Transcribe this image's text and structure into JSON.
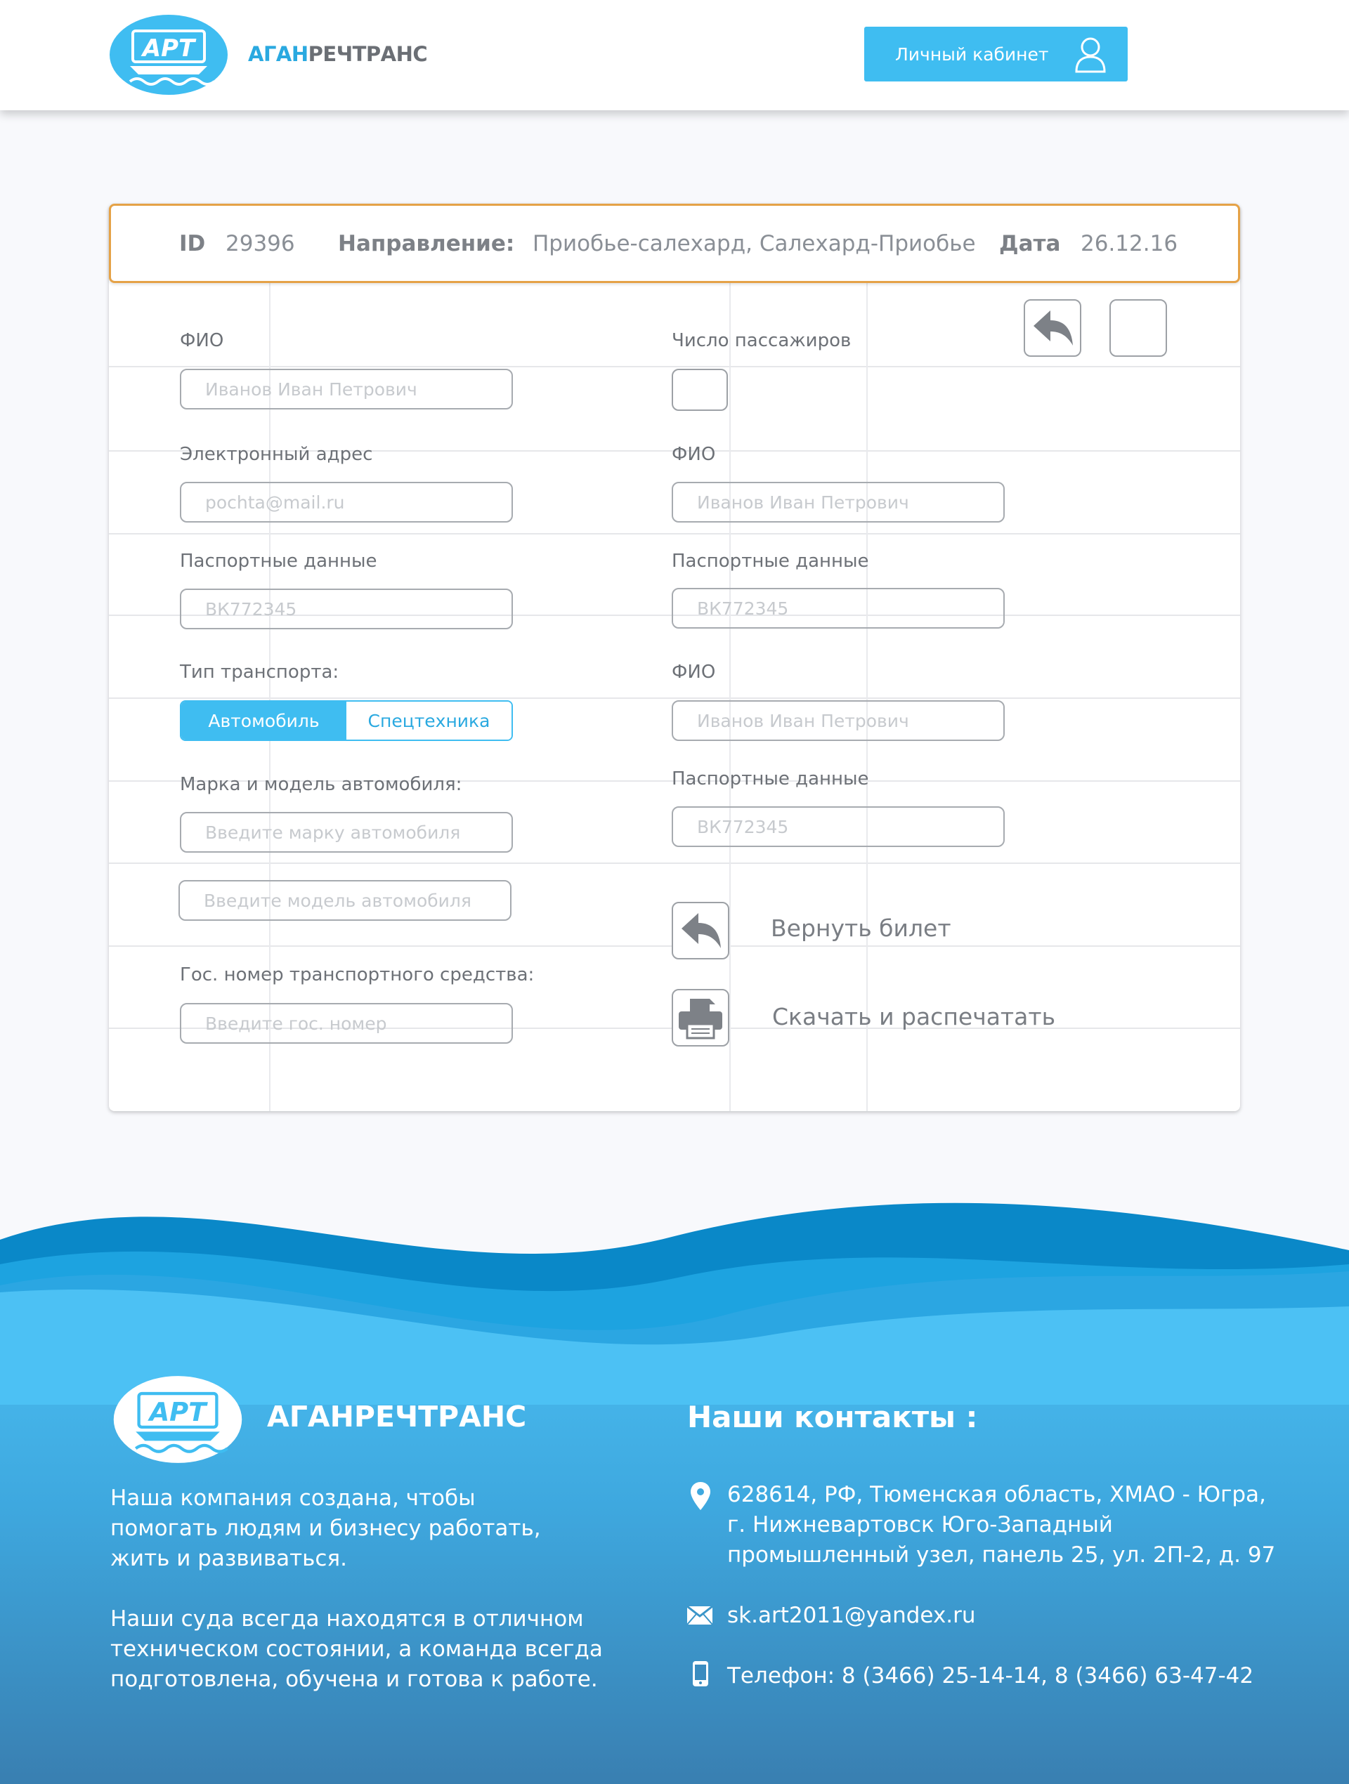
{
  "header": {
    "logo_text": "АРТ",
    "brand_part1": "АГАН",
    "brand_part2": "РЕЧТРАНС",
    "cabinet_label": "Личный кабинет"
  },
  "ticket": {
    "id_label": "ID",
    "id_value": "29396",
    "direction_label": "Направление:",
    "direction_value": "Приобье-салехард, Салехард-Приобье",
    "date_label": "Дата",
    "date_value": "26.12.16"
  },
  "form": {
    "fio_label": "ФИО",
    "fio_placeholder": "Иванов Иван Петрович",
    "email_label": "Электронный адрес",
    "email_placeholder": "pochta@mail.ru",
    "passport_label": "Паспортные данные",
    "passport_placeholder": "ВК772345",
    "transport_label": "Тип транспорта:",
    "transport_options": [
      "Автомобиль",
      "Спецтехника"
    ],
    "car_label": "Марка и модель автомобиля:",
    "car_make_placeholder": "Введите марку автомобиля",
    "car_model_placeholder": "Введите модель автомобиля",
    "plate_label": "Гос. номер транспортного средства:",
    "plate_placeholder": "Введите гос. номер",
    "passengers_label": "Число пассажиров",
    "passengers": [
      {
        "fio_label": "ФИО",
        "fio_placeholder": "Иванов Иван Петрович",
        "passport_label": "Паспортные данные",
        "passport_placeholder": "ВК772345"
      },
      {
        "fio_label": "ФИО",
        "fio_placeholder": "Иванов Иван Петрович",
        "passport_label": "Паспортные данные",
        "passport_placeholder": "ВК772345"
      }
    ]
  },
  "actions": {
    "return_label": "Вернуть билет",
    "print_label": "Скачать и распечатать"
  },
  "footer": {
    "brand": "АГАНРЕЧТРАНС",
    "about_1": [
      "Наша компания создана, чтобы",
      "помогать людям и бизнесу работать,",
      "жить и развиваться."
    ],
    "about_2": [
      "Наши суда всегда находятся в отличном",
      "техническом состоянии, а команда всегда",
      "подготовлена, обучена и готова к работе."
    ],
    "contacts_title": "Наши контакты :",
    "address": [
      "628614, РФ, Тюменская область, ХМАО - Югра,",
      "г. Нижневартовск Юго-Западный",
      "промышленный узел, панель 25, ул. 2П-2, д. 97"
    ],
    "email": "sk.art2011@yandex.ru",
    "phone": "Телефон: 8 (3466) 25-14-14, 8 (3466) 63-47-42"
  },
  "colors": {
    "accent": "#3fbdf1",
    "brand_blue": "#2aa9e0",
    "id_border": "#e5a247",
    "footer_top": "#4cc1f4",
    "footer_bottom": "#397fb1"
  }
}
